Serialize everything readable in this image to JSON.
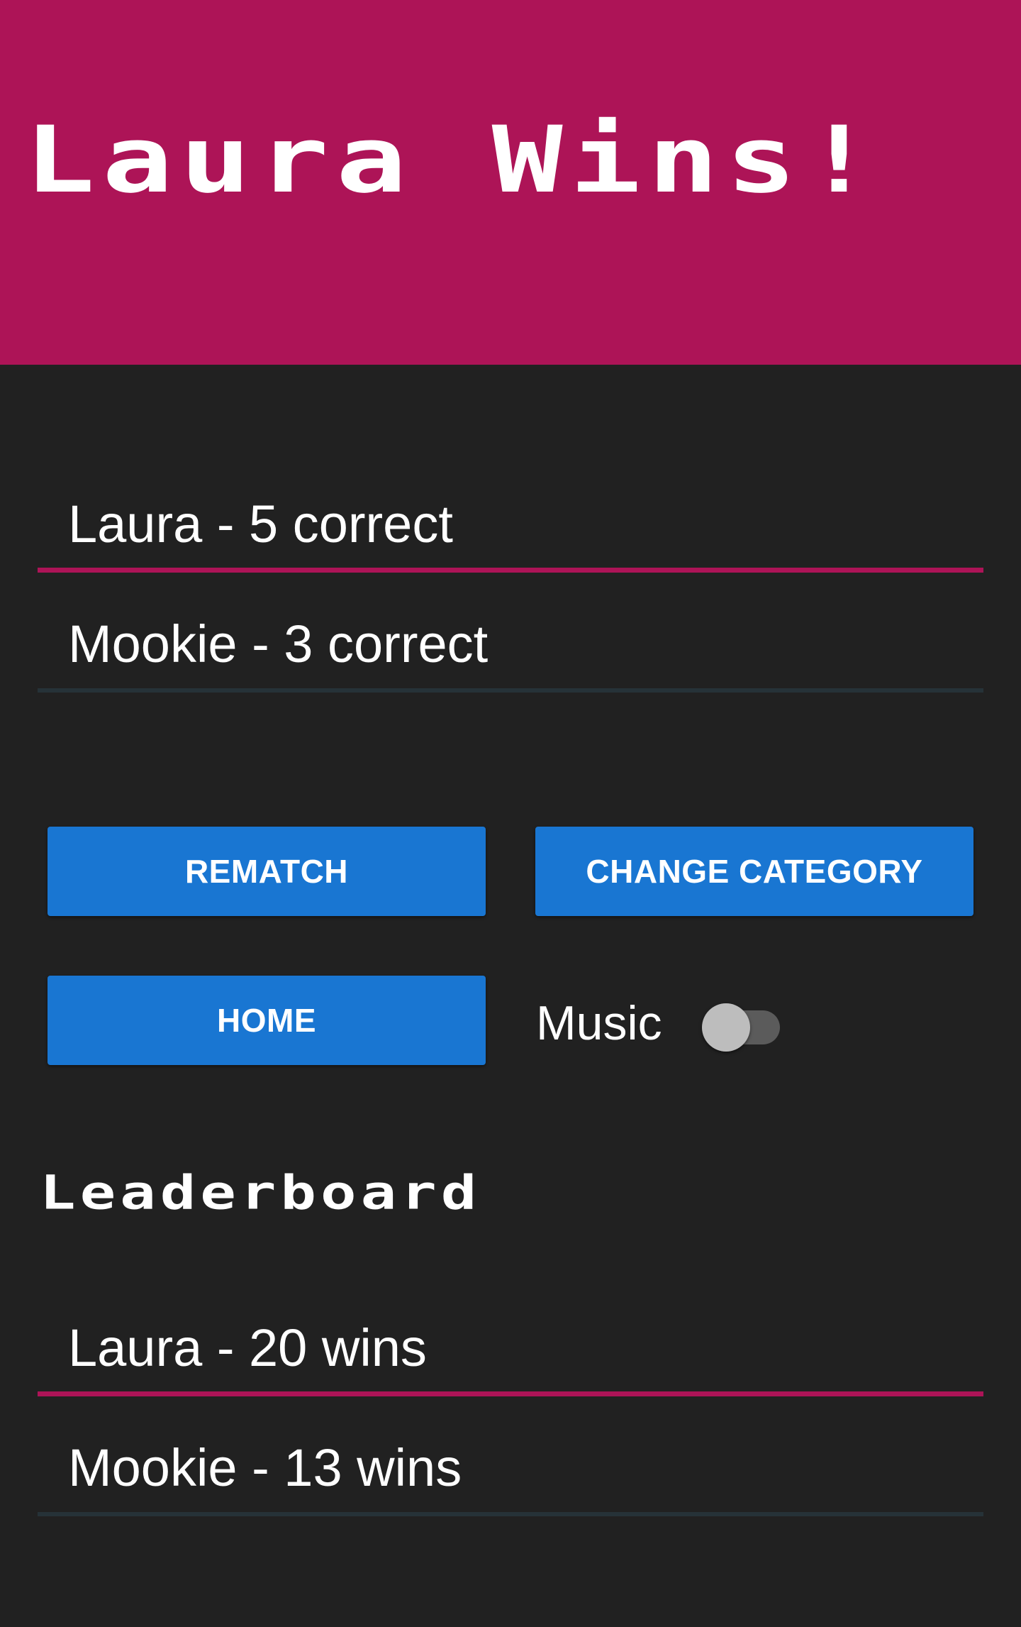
{
  "header": {
    "title": "Laura Wins!",
    "background_color": "#ad1457"
  },
  "scores": [
    {
      "text": "Laura - 5 correct",
      "highlighted": true
    },
    {
      "text": "Mookie - 3 correct",
      "highlighted": false
    }
  ],
  "actions": {
    "rematch_label": "REMATCH",
    "change_category_label": "CHANGE CATEGORY",
    "home_label": "HOME",
    "button_color": "#1976d2"
  },
  "music": {
    "label": "Music",
    "enabled": false
  },
  "leaderboard": {
    "title": "Leaderboard",
    "entries": [
      {
        "text": "Laura - 20 wins",
        "highlighted": true
      },
      {
        "text": "Mookie - 13 wins",
        "highlighted": false
      }
    ]
  },
  "colors": {
    "background": "#212121",
    "accent": "#ad1457",
    "divider": "#263238"
  }
}
